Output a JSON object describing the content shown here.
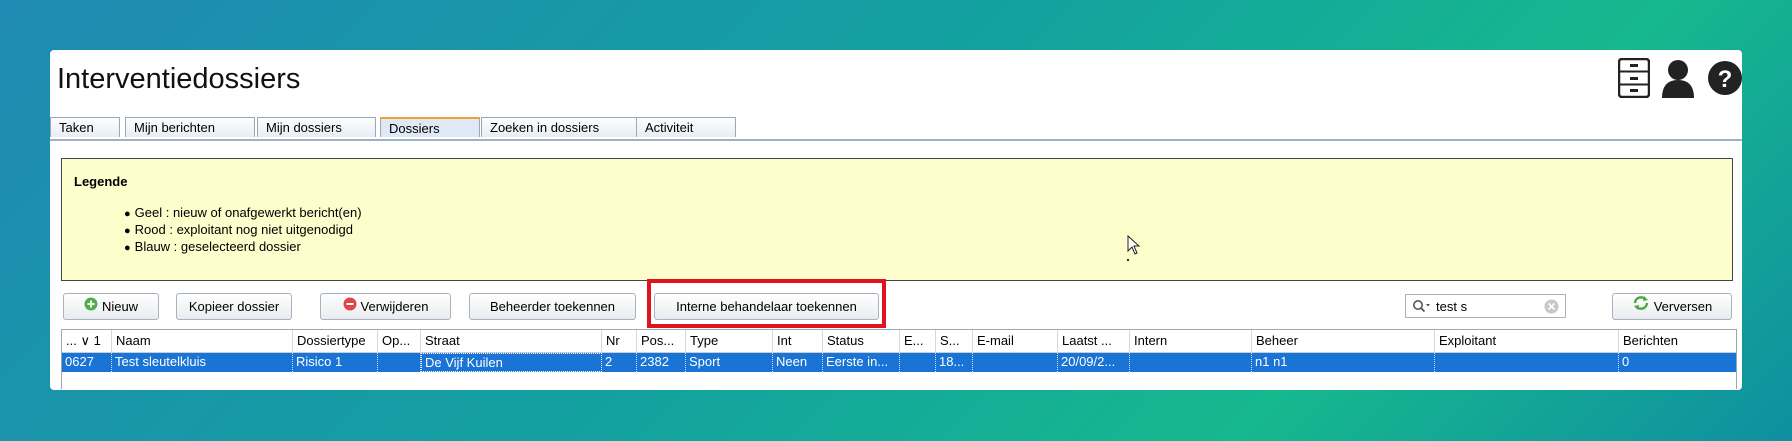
{
  "window": {
    "title": "Interventiedossiers"
  },
  "top_icons": [
    "file-cabinet-icon",
    "user-icon",
    "help-icon"
  ],
  "tabs": [
    {
      "label": "Taken"
    },
    {
      "label": "Mijn berichten"
    },
    {
      "label": "Mijn dossiers"
    },
    {
      "label": "Dossiers",
      "active": true
    },
    {
      "label": "Zoeken in dossiers"
    },
    {
      "label": "Activiteit"
    }
  ],
  "legend": {
    "title": "Legende",
    "items": [
      "Geel : nieuw of onafgewerkt bericht(en)",
      "Rood : exploitant nog niet uitgenodigd",
      "Blauw : geselecteerd dossier"
    ]
  },
  "toolbar": {
    "new_label": "Nieuw",
    "copy_label": "Kopieer dossier",
    "delete_label": "Verwijderen",
    "assign_manager_label": "Beheerder toekennen",
    "assign_internal_label": "Interne behandelaar toekennen",
    "search_value": "test s",
    "refresh_label": "Verversen"
  },
  "table": {
    "columns": [
      "... ∨ 1",
      "Naam",
      "Dossiertype",
      "Op...",
      "Straat",
      "Nr",
      "Pos...",
      "Type",
      "Int",
      "Status",
      "E...",
      "S...",
      "E-mail",
      "Laatst ...",
      "Intern",
      "Beheer",
      "Exploitant",
      "Berichten"
    ],
    "rows": [
      [
        "0627",
        "Test sleutelkluis",
        "Risico 1",
        "",
        "De Vijf Kuilen",
        "2",
        "2382",
        "Sport",
        "Neen",
        "Eerste in...",
        "",
        "18...",
        "",
        "20/09/2...",
        "",
        "n1 n1",
        "",
        "0"
      ]
    ]
  },
  "colors": {
    "selected_row": "#1a74d6",
    "legend_bg": "#fefdcc",
    "highlight": "#e0141e"
  }
}
